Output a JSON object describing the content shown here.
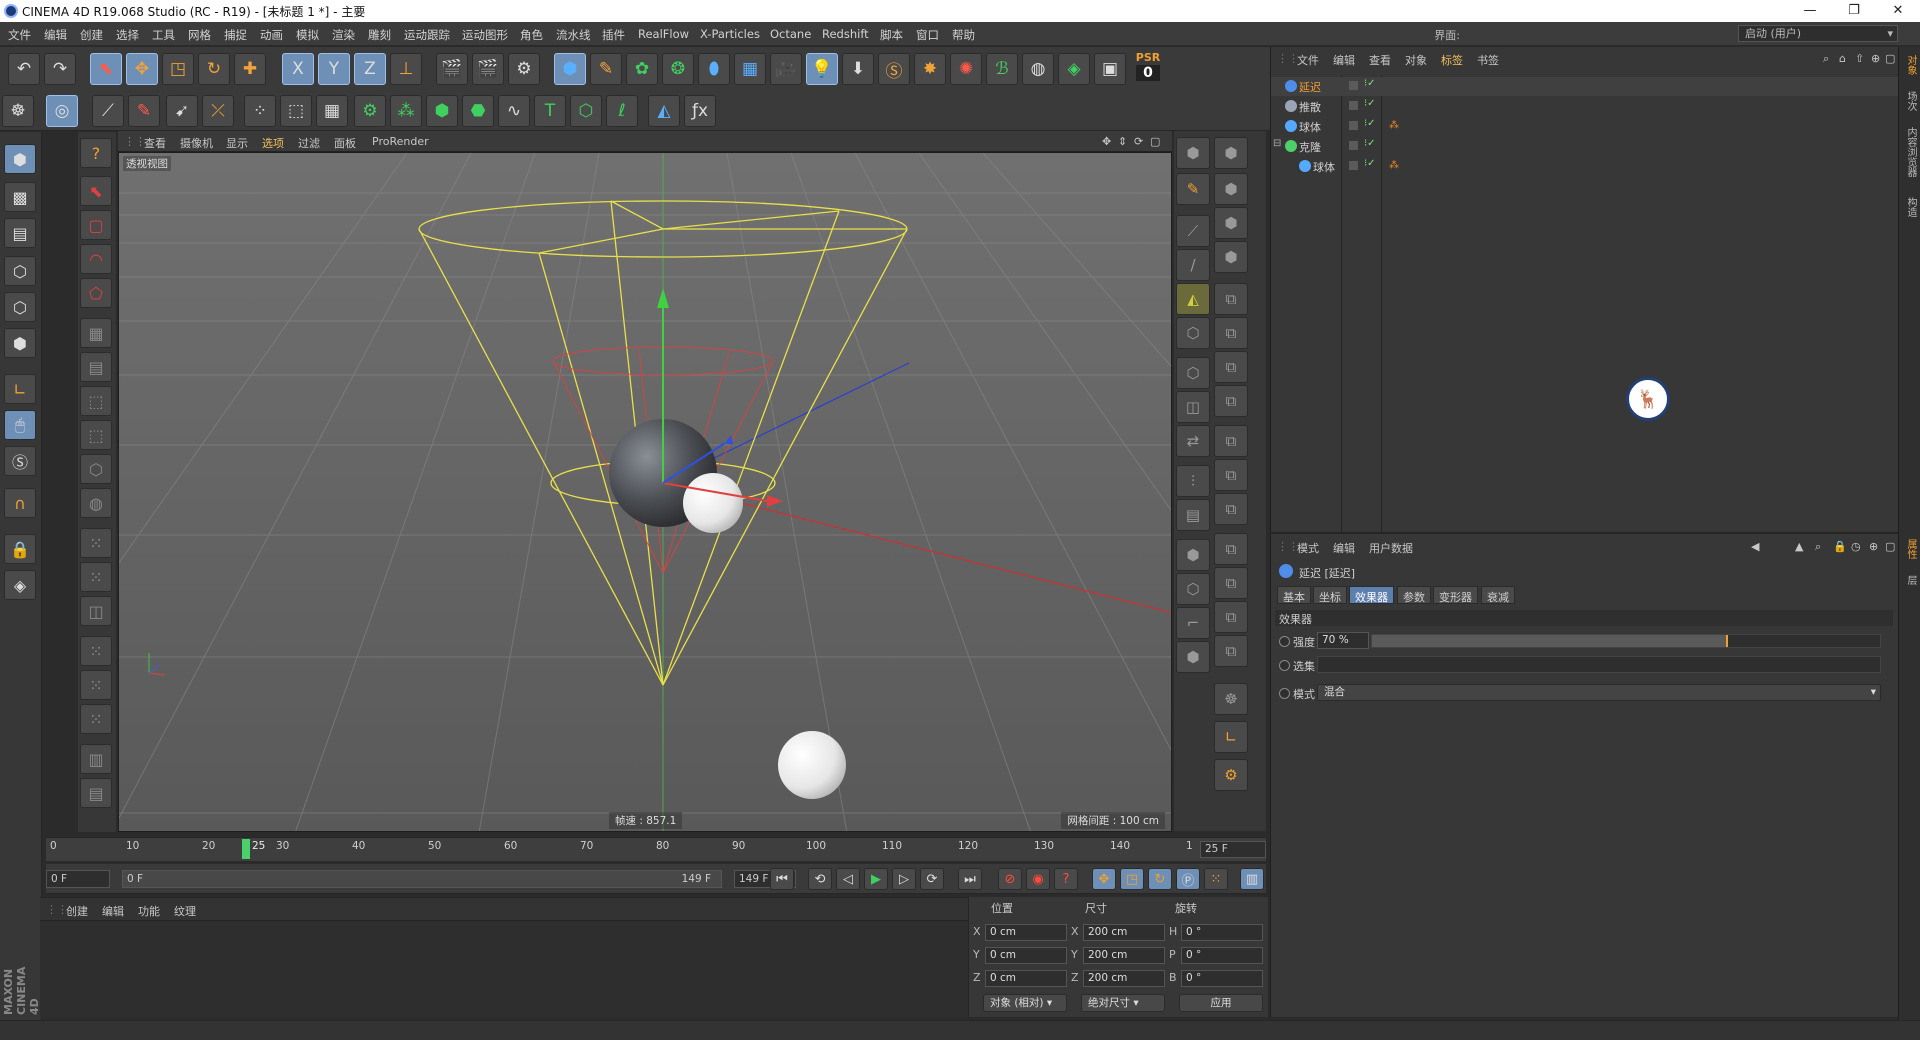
{
  "window": {
    "title": "CINEMA 4D R19.068 Studio (RC - R19) - [未标题 1 *] - 主要",
    "controls": [
      "—",
      "❐",
      "✕"
    ]
  },
  "menubar": {
    "items": [
      "文件",
      "编辑",
      "创建",
      "选择",
      "工具",
      "网格",
      "捕捉",
      "动画",
      "模拟",
      "渲染",
      "雕刻",
      "运动跟踪",
      "运动图形",
      "角色",
      "流水线",
      "插件",
      "RealFlow",
      "X-Particles",
      "Octane",
      "Redshift",
      "脚本",
      "窗口",
      "帮助"
    ],
    "layout_label": "界面:",
    "layout_value": "启动 (用户)"
  },
  "toolbar": {
    "psr_label": "PSR",
    "psr_value": "0",
    "axis_x": "X",
    "axis_y": "Y",
    "axis_z": "Z"
  },
  "viewport": {
    "menu": [
      "查看",
      "摄像机",
      "显示",
      "选项",
      "过滤",
      "面板",
      "ProRender"
    ],
    "label": "透视视图",
    "speed": "帧速 : 857.1",
    "grid": "网格间距 : 100 cm"
  },
  "timeline": {
    "ticks": [
      "0",
      "10",
      "20",
      "30",
      "40",
      "50",
      "60",
      "70",
      "80",
      "90",
      "100",
      "110",
      "120",
      "130",
      "140",
      "1"
    ],
    "current_frame": "25",
    "fps": "25 F"
  },
  "transport": {
    "start": "0 F",
    "range_start": "0 F",
    "range_end": "149 F",
    "end": "149 F"
  },
  "material_manager": {
    "menu": [
      "创建",
      "编辑",
      "功能",
      "纹理"
    ]
  },
  "coordinates": {
    "headers": [
      "位置",
      "尺寸",
      "旋转"
    ],
    "rows": [
      {
        "a": "X",
        "pos": "0 cm",
        "b": "X",
        "size": "200 cm",
        "c": "H",
        "rot": "0 °"
      },
      {
        "a": "Y",
        "pos": "0 cm",
        "b": "Y",
        "size": "200 cm",
        "c": "P",
        "rot": "0 °"
      },
      {
        "a": "Z",
        "pos": "0 cm",
        "b": "Z",
        "size": "200 cm",
        "c": "B",
        "rot": "0 °"
      }
    ],
    "mode1": "对象 (相对)",
    "mode2": "绝对尺寸",
    "apply": "应用"
  },
  "object_manager": {
    "menu": [
      "文件",
      "编辑",
      "查看",
      "对象",
      "标签",
      "书签"
    ],
    "objects": [
      {
        "name": "延迟",
        "selected": true,
        "color": "#4e8ee8"
      },
      {
        "name": "推散",
        "selected": false,
        "color": "#9aa4b6"
      },
      {
        "name": "球体",
        "selected": false,
        "color": "#55aaff"
      },
      {
        "name": "克隆",
        "selected": false,
        "color": "#4fcf6a"
      },
      {
        "name": "球体",
        "selected": false,
        "color": "#55aaff"
      }
    ]
  },
  "attribute_manager": {
    "menu": [
      "模式",
      "编辑",
      "用户数据"
    ],
    "object_title": "延迟 [延迟]",
    "tabs": [
      "基本",
      "坐标",
      "效果器",
      "参数",
      "变形器",
      "衰减"
    ],
    "selected_tab": "效果器",
    "section": "效果器",
    "strength_label": "强度",
    "strength_value": "70 %",
    "strength_fraction": 0.7,
    "selection_label": "选集",
    "mode_label": "模式",
    "mode_value": "混合"
  },
  "side_tabs": [
    "对象",
    "场次",
    "内容浏览器",
    "构造",
    "属性",
    "层"
  ],
  "brand": "MAXON CINEMA 4D",
  "colors": {
    "accent": "#5d7fae",
    "selected_orange": "#f0a030",
    "playhead": "#49d26b",
    "cone_yellow": "#e8e04a",
    "cone_red": "#e04040"
  }
}
